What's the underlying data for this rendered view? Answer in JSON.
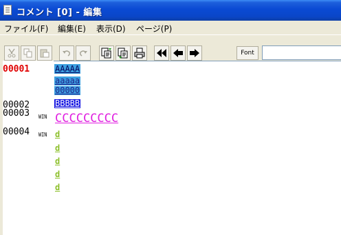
{
  "window": {
    "title": "コメント [0] - 編集"
  },
  "menu": [
    {
      "label": "ファイル(F)"
    },
    {
      "label": "編集(E)"
    },
    {
      "label": "表示(D)"
    },
    {
      "label": "ページ(P)"
    }
  ],
  "toolbar": {
    "buttons": [
      {
        "icon": "cut-icon"
      },
      {
        "icon": "copy-icon"
      },
      {
        "icon": "paste-icon"
      },
      {
        "icon": "undo-icon"
      },
      {
        "icon": "redo-icon"
      },
      {
        "icon": "insert-page-icon"
      },
      {
        "icon": "copy-page-icon"
      },
      {
        "icon": "print-icon"
      },
      {
        "icon": "first-icon"
      },
      {
        "icon": "back-icon"
      },
      {
        "icon": "forward-icon"
      }
    ],
    "font_label": "Font",
    "field_value": ""
  },
  "editor": {
    "line_numbers": [
      "00001",
      "00002",
      "00003",
      "00004"
    ],
    "win_tags": [
      "WIN",
      "WIN"
    ],
    "lines": [
      {
        "text": "AAAAA"
      },
      {
        "text": "aaaaa"
      },
      {
        "text": "00000"
      },
      {
        "text": "BBBBB"
      },
      {
        "text": "CCCCCCCCC"
      },
      {
        "text": "d"
      },
      {
        "text": "d"
      },
      {
        "text": "d"
      },
      {
        "text": "d"
      },
      {
        "text": "d"
      }
    ]
  },
  "colors": {
    "title_bar": "#0a46c8",
    "active_line_number": "#e00000",
    "selection_light": "#3ca0e0",
    "selection_dark": "#1010e0",
    "magenta_text": "#e020e0",
    "green_text": "#8cbf2a"
  }
}
